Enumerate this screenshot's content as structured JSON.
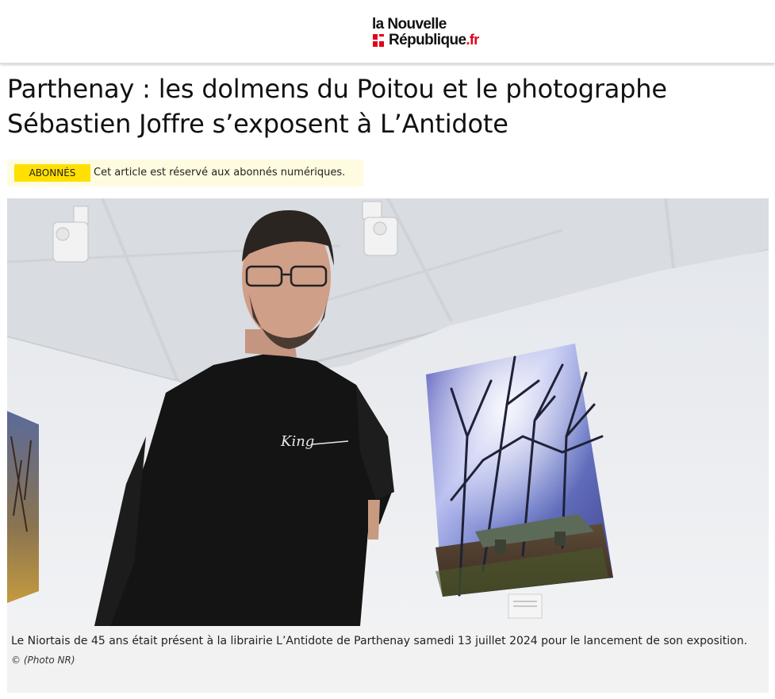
{
  "header": {
    "logo_line1": "la Nouvelle",
    "logo_line2": "République",
    "logo_tld": ".fr",
    "brand_color": "#e2001a"
  },
  "article": {
    "title": "Parthenay : les dolmens du Poitou et le photographe Sébastien Joffre s’exposent à L’Antidote",
    "badge": "ABONNÉS",
    "badge_color": "#ffe000",
    "paywall_notice": "Cet article est réservé aux abonnés numériques.",
    "photo": {
      "shirt_text": "King",
      "caption": "Le Niortais de 45 ans était présent à la librairie L’Antidote de Parthenay samedi 13 juillet 2024 pour le lancement de son exposition.",
      "credit": "© (Photo NR)"
    }
  }
}
